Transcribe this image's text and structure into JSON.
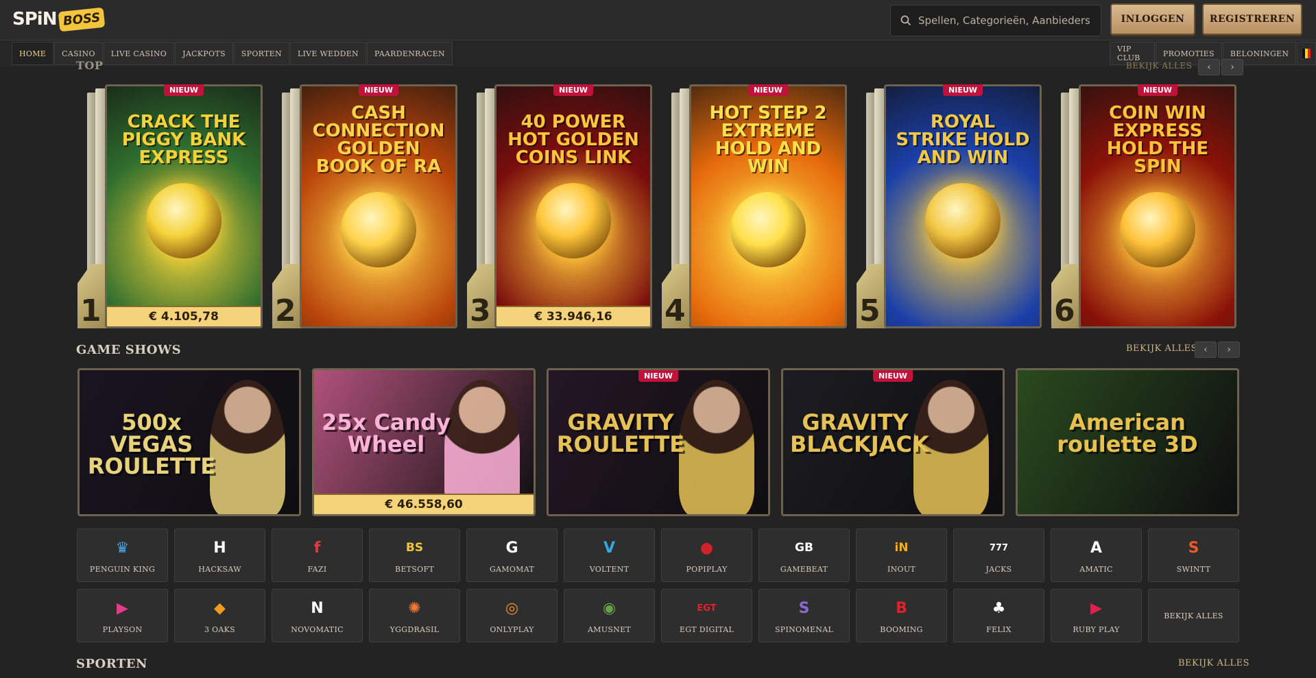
{
  "header": {
    "logo_text": "SPiN",
    "logo_badge": "BOSS",
    "search_placeholder": "Spellen, Categorieën, Aanbieders",
    "login_label": "INLOGGEN",
    "register_label": "REGISTREREN"
  },
  "nav": {
    "left": [
      "HOME",
      "CASINO",
      "LIVE CASINO",
      "JACKPOTS",
      "SPORTEN",
      "LIVE WEDDEN",
      "PAARDENRACEN"
    ],
    "right": [
      "VIP CLUB",
      "PROMOTIES",
      "BELONINGEN"
    ]
  },
  "top": {
    "title": "TOP",
    "see_all": "BEKIJK ALLES",
    "new_badge": "NIEUW",
    "cards": [
      {
        "rank": "1",
        "title": "CRACK THE PIGGY BANK EXPRESS",
        "jackpot": "€ 4.105,78",
        "new": true,
        "bg": "#2f6d2e",
        "accent": "#f5d23a"
      },
      {
        "rank": "2",
        "title": "CASH CONNECTION GOLDEN BOOK OF RA",
        "jackpot": "",
        "new": true,
        "bg": "#b8440a",
        "accent": "#ffd24a"
      },
      {
        "rank": "3",
        "title": "40 POWER HOT GOLDEN COINS LINK",
        "jackpot": "€ 33.946,16",
        "new": true,
        "bg": "#7a0d0d",
        "accent": "#ffc63a"
      },
      {
        "rank": "4",
        "title": "HOT STEP 2 EXTREME HOLD AND WIN",
        "jackpot": "",
        "new": true,
        "bg": "#e66a0c",
        "accent": "#ffe04a"
      },
      {
        "rank": "5",
        "title": "ROYAL STRIKE HOLD AND WIN",
        "jackpot": "",
        "new": true,
        "bg": "#1a3fa8",
        "accent": "#f3c846"
      },
      {
        "rank": "6",
        "title": "COIN WIN EXPRESS HOLD THE SPIN",
        "jackpot": "",
        "new": true,
        "bg": "#8a1208",
        "accent": "#ffc23a"
      }
    ]
  },
  "game_shows": {
    "title": "GAME SHOWS",
    "see_all": "BEKIJK ALLES",
    "cards": [
      {
        "title": "500x VEGAS ROULETTE",
        "jackpot": "",
        "new": false,
        "bg": "#1a1420",
        "accent": "#e8d27a"
      },
      {
        "title": "25x Candy Wheel",
        "jackpot": "€ 46.558,60",
        "new": false,
        "bg": "#b0527a",
        "accent": "#ffb3d9"
      },
      {
        "title": "GRAVITY ROULETTE",
        "jackpot": "",
        "new": true,
        "bg": "#241624",
        "accent": "#e6c256"
      },
      {
        "title": "GRAVITY BLACKJACK",
        "jackpot": "",
        "new": true,
        "bg": "#1c1c22",
        "accent": "#e6c256"
      },
      {
        "title": "American roulette 3D",
        "jackpot": "",
        "new": false,
        "bg": "#2a4a1e",
        "accent": "#e8c050"
      }
    ]
  },
  "providers": [
    {
      "name": "PENGUIN KING",
      "glyph": "♛",
      "color": "#4aa3e0"
    },
    {
      "name": "HACKSAW",
      "glyph": "H",
      "color": "#ffffff"
    },
    {
      "name": "FAZI",
      "glyph": "f",
      "color": "#e03a3a"
    },
    {
      "name": "BETSOFT",
      "glyph": "BS",
      "color": "#f2c53d"
    },
    {
      "name": "GAMOMAT",
      "glyph": "G",
      "color": "#ffffff"
    },
    {
      "name": "VOLTENT",
      "glyph": "V",
      "color": "#35a8e0"
    },
    {
      "name": "POPIPLAY",
      "glyph": "●",
      "color": "#d0222a"
    },
    {
      "name": "GAMEBEAT",
      "glyph": "GB",
      "color": "#ffffff"
    },
    {
      "name": "INOUT",
      "glyph": "iN",
      "color": "#f2b01e"
    },
    {
      "name": "JACKS",
      "glyph": "777",
      "color": "#ffffff"
    },
    {
      "name": "AMATIC",
      "glyph": "A",
      "color": "#ffffff"
    },
    {
      "name": "SWINTT",
      "glyph": "S",
      "color": "#f0582a"
    },
    {
      "name": "PLAYSON",
      "glyph": "▶",
      "color": "#e63a8a"
    },
    {
      "name": "3 OAKS",
      "glyph": "◆",
      "color": "#f29a1e"
    },
    {
      "name": "NOVOMATIC",
      "glyph": "N",
      "color": "#ffffff"
    },
    {
      "name": "YGGDRASIL",
      "glyph": "✺",
      "color": "#f07a3a"
    },
    {
      "name": "ONLYPLAY",
      "glyph": "◎",
      "color": "#f08a2a"
    },
    {
      "name": "AMUSNET",
      "glyph": "◉",
      "color": "#6aa04a"
    },
    {
      "name": "EGT DIGITAL",
      "glyph": "EGT",
      "color": "#e0222a"
    },
    {
      "name": "SPINOMENAL",
      "glyph": "S",
      "color": "#8a6ad0"
    },
    {
      "name": "BOOMING",
      "glyph": "B",
      "color": "#e0222a"
    },
    {
      "name": "FELIX",
      "glyph": "♣",
      "color": "#ffffff"
    },
    {
      "name": "RUBY PLAY",
      "glyph": "▶",
      "color": "#e0224a"
    }
  ],
  "providers_see_all": "BEKIJK ALLES",
  "sporten": {
    "title": "SPORTEN",
    "see_all": "BEKIJK ALLES"
  }
}
